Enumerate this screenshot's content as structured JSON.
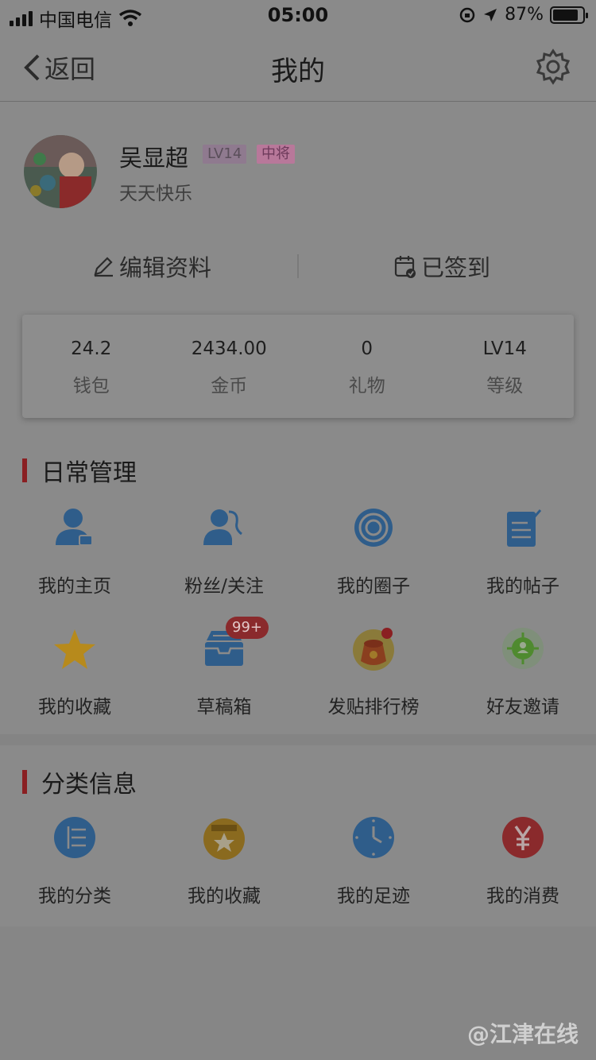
{
  "status_bar": {
    "carrier": "中国电信",
    "time": "05:00",
    "battery_percent": "87%",
    "battery_level": 0.87
  },
  "nav": {
    "back_label": "返回",
    "title": "我的",
    "settings_icon": "gear-icon"
  },
  "profile": {
    "name": "吴显超",
    "level_badge": "LV14",
    "rank_badge": "中将",
    "motto": "天天快乐",
    "edit_label": "编辑资料",
    "signed_label": "已签到"
  },
  "stats": [
    {
      "value": "24.2",
      "label": "钱包"
    },
    {
      "value": "2434.00",
      "label": "金币"
    },
    {
      "value": "0",
      "label": "礼物"
    },
    {
      "value": "LV14",
      "label": "等级"
    }
  ],
  "daily": {
    "title": "日常管理",
    "items": [
      {
        "label": "我的主页",
        "icon": "user-home-icon",
        "color": "#2f5d8a"
      },
      {
        "label": "粉丝/关注",
        "icon": "followers-icon",
        "color": "#2f5d8a"
      },
      {
        "label": "我的圈子",
        "icon": "circle-icon",
        "color": "#2f5d8a"
      },
      {
        "label": "我的帖子",
        "icon": "post-icon",
        "color": "#2f5d8a"
      },
      {
        "label": "我的收藏",
        "icon": "star-icon",
        "color": "#b78a1c"
      },
      {
        "label": "草稿箱",
        "icon": "drafts-icon",
        "color": "#2f5d8a",
        "badge": "99+"
      },
      {
        "label": "发贴排行榜",
        "icon": "ranking-bag-icon",
        "color": "#8a3f1f"
      },
      {
        "label": "好友邀请",
        "icon": "invite-friend-icon",
        "color": "#4f8a2f"
      }
    ]
  },
  "category": {
    "title": "分类信息",
    "items": [
      {
        "label": "我的分类",
        "icon": "list-icon",
        "color": "#2f5d8a"
      },
      {
        "label": "我的收藏",
        "icon": "favorite-box-icon",
        "color": "#8a6a1f"
      },
      {
        "label": "我的足迹",
        "icon": "clock-icon",
        "color": "#2f5d8a"
      },
      {
        "label": "我的消费",
        "icon": "yuan-icon",
        "color": "#8a2a2c"
      }
    ]
  },
  "watermark": "@江津在线"
}
